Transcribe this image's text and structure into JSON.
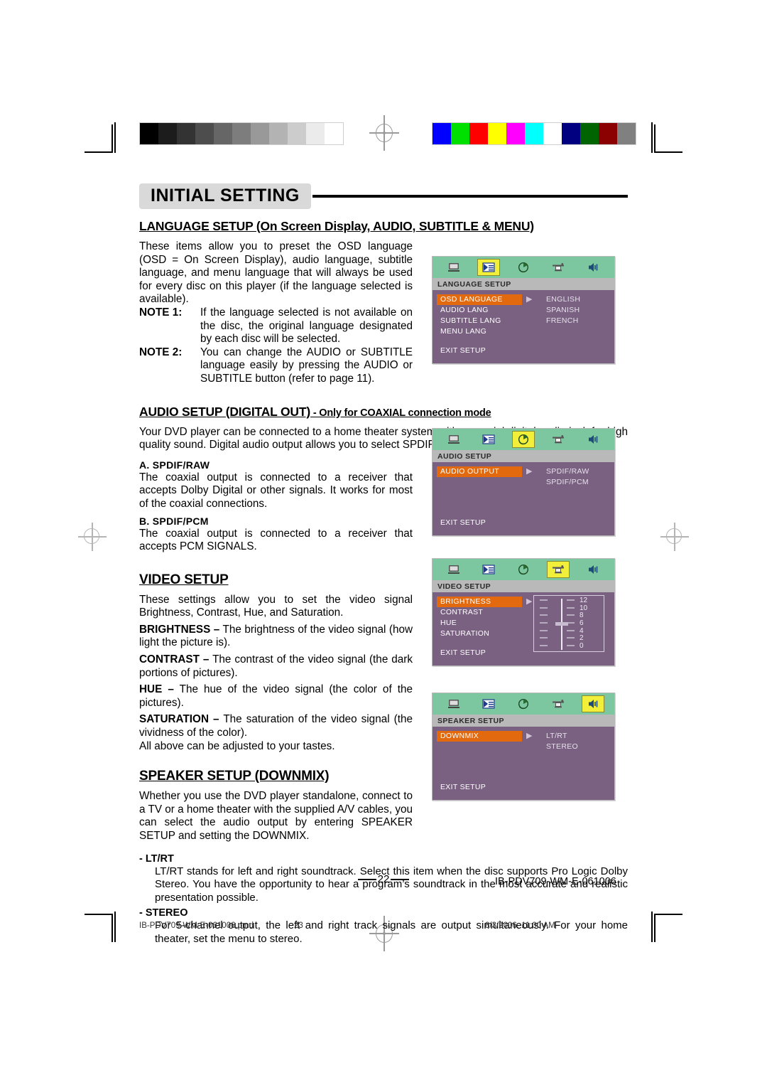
{
  "chapter": {
    "title": "INITIAL SETTING"
  },
  "sections": {
    "language": {
      "heading_main": "LANGUAGE SETUP (On Screen Display, AUDIO, SUBTITLE & MENU)",
      "intro": "These items allow you to preset the OSD language (OSD = On Screen Display), audio language, subtitle language, and menu language that will always be used for every disc on this player (if the language selected is available).",
      "note1_label": "NOTE 1:",
      "note1_text": "If the language selected is not available on the disc, the original language designated by each disc will be selected.",
      "note2_label": "NOTE 2:",
      "note2_text": "You can change the AUDIO or SUBTITLE language easily by pressing the AUDIO or SUBTITLE button (refer to page 11)."
    },
    "audio": {
      "heading_main": "AUDIO SETUP (DIGITAL OUT)",
      "heading_sub": " - Only for COAXIAL connection mode",
      "intro": "Your DVD player can be connected to a home theater system with a coaxial digital audio jack for high quality sound. Digital audio output allows you to select SPDIF/RAW or SPDIF/PCM digital signal.",
      "item_a_title": "A. SPDIF/RAW",
      "item_a_text": "The coaxial output is connected to a receiver that accepts Dolby Digital or other signals. It works for most of the coaxial connections.",
      "item_b_title": "B. SPDIF/PCM",
      "item_b_text": "The coaxial output is connected to a receiver that accepts PCM SIGNALS."
    },
    "video": {
      "heading": "VIDEO SETUP",
      "intro": "These settings allow you to set the video signal Brightness, Contrast, Hue, and Saturation.",
      "brightness_label": "BRIGHTNESS –",
      "brightness_text": " The brightness of the video signal (how light the picture is).",
      "contrast_label": "CONTRAST –",
      "contrast_text": " The contrast of the video signal (the dark portions of pictures).",
      "hue_label": "HUE –",
      "hue_text": " The hue of the video signal (the color of the pictures).",
      "saturation_label": "SATURATION –",
      "saturation_text": " The saturation of the video signal (the vividness of the color).",
      "outro": "All above can be adjusted to your tastes."
    },
    "speaker": {
      "heading": "SPEAKER SETUP (DOWNMIX)",
      "intro": "Whether you use the DVD player standalone, connect to a TV or a home theater with the supplied A/V cables, you can select the audio output by entering SPEAKER SETUP and setting the DOWNMIX.",
      "ltrt_label": "-  LT/RT",
      "ltrt_text": "LT/RT stands for left and right soundtrack. Select this item when the disc supports Pro Logic Dolby Stereo. You have the opportunity to hear a program’s soundtrack in the most accurate and realistic presentation possible.",
      "stereo_label": "-  STEREO",
      "stereo_text": "For 5-channel output, the left and right track signals are output simultaneously. For your home theater, set the menu to stereo."
    }
  },
  "osd_screens": {
    "language": {
      "title": "LANGUAGE  SETUP",
      "selected_icon_index": 1,
      "menu": [
        {
          "label": "OSD LANGUAGE",
          "highlighted": true
        },
        {
          "label": "AUDIO LANG",
          "highlighted": false
        },
        {
          "label": "SUBTITLE LANG",
          "highlighted": false
        },
        {
          "label": "MENU LANG",
          "highlighted": false
        }
      ],
      "values": [
        "ENGLISH",
        "SPANISH",
        "FRENCH"
      ],
      "arrow": "▶",
      "exit": "EXIT SETUP"
    },
    "audio": {
      "title": "AUDIO SETUP",
      "selected_icon_index": 2,
      "menu": [
        {
          "label": "AUDIO OUTPUT",
          "highlighted": true
        }
      ],
      "values": [
        "SPDIF/RAW",
        "SPDIF/PCM"
      ],
      "arrow": "▶",
      "exit": "EXIT SETUP"
    },
    "video": {
      "title": "VIDEO SETUP",
      "selected_icon_index": 3,
      "menu": [
        {
          "label": "BRIGHTNESS",
          "highlighted": true
        },
        {
          "label": "CONTRAST",
          "highlighted": false
        },
        {
          "label": "HUE",
          "highlighted": false
        },
        {
          "label": "SATURATION",
          "highlighted": false
        }
      ],
      "slider_scale": [
        "12",
        "10",
        "8",
        "6",
        "4",
        "2",
        "0"
      ],
      "slider_value": "6",
      "arrow": "▶",
      "exit": "EXIT SETUP"
    },
    "speaker": {
      "title": "SPEAKER SETUP",
      "selected_icon_index": 4,
      "menu": [
        {
          "label": "DOWNMIX",
          "highlighted": true
        }
      ],
      "values": [
        "LT/RT",
        "STEREO"
      ],
      "arrow": "▶",
      "exit": "EXIT SETUP"
    },
    "icon_names": [
      "general-setup-icon",
      "language-setup-icon",
      "audio-setup-icon",
      "video-setup-icon",
      "speaker-setup-icon"
    ]
  },
  "footer": {
    "page_number": "22",
    "doc_code": "IB-PDV709-WM-E-061006",
    "file_name": "IB-PDV709-WM-E-061006.pmd",
    "sheet_number": "23",
    "timestamp": "8/3/2006, 11:00 AM"
  },
  "calibration": {
    "grayscale": [
      "#000000",
      "#1c1c1c",
      "#333333",
      "#4d4d4d",
      "#666666",
      "#7d7d7d",
      "#999999",
      "#b3b3b3",
      "#cccccc",
      "#ebebeb",
      "#ffffff"
    ],
    "colorbars": [
      "#0000ff",
      "#00e000",
      "#ff0000",
      "#ffff00",
      "#ff00ff",
      "#00ffff",
      "#ffffff",
      "#000080",
      "#006400",
      "#8b0000",
      "#808080"
    ]
  },
  "colors": {
    "osd_background": "#7a6182",
    "osd_icon_bar": "#7dc7a0",
    "osd_highlight": "#e2690d",
    "osd_titlebar": "#b9b9b9",
    "osd_icon_selected": "#f2ef3a",
    "chapter_chip": "#d9d9d9"
  }
}
